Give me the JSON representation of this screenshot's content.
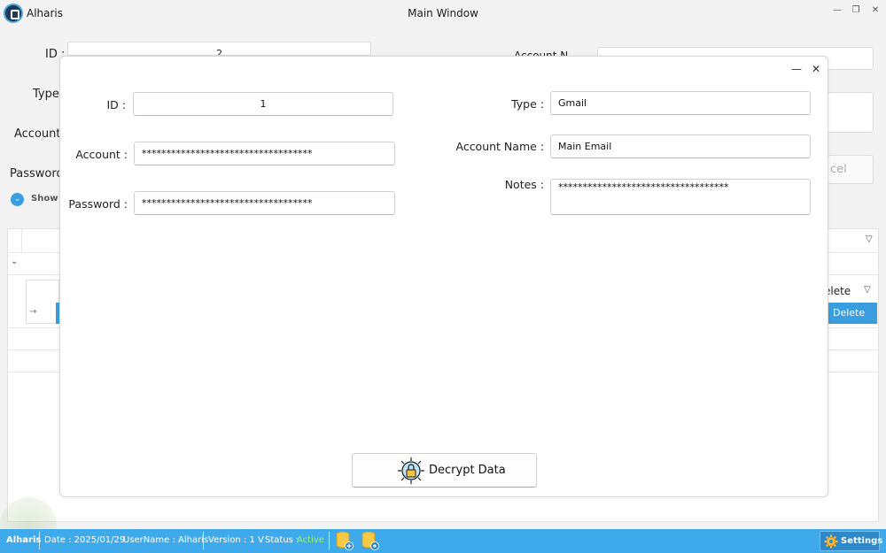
{
  "window": {
    "app_name": "Alharis",
    "title": "Main Window",
    "min_glyph": "—",
    "max_glyph": "❐",
    "close_glyph": "✕"
  },
  "background_form": {
    "id_label": "ID :",
    "id_value": "2",
    "type_label": "Type",
    "account_label": "Account",
    "password_label": "Password",
    "show_label": "Show r",
    "account_name_label": "Account N",
    "cancel_label": "cel",
    "grid": {
      "delete_header": "elete",
      "delete_button": "Delete",
      "expand_glyph": "⌄",
      "row_arrow": "→"
    }
  },
  "dialog": {
    "minimize_glyph": "—",
    "close_glyph": "✕",
    "fields": {
      "id": {
        "label": "ID :",
        "value": "1"
      },
      "account": {
        "label": "Account :",
        "value": "***********************************"
      },
      "password": {
        "label": "Password :",
        "value": "***********************************"
      },
      "type": {
        "label": "Type :",
        "value": "Gmail"
      },
      "account_name": {
        "label": "Account Name :",
        "value": "Main Email"
      },
      "notes": {
        "label": "Notes :",
        "value": "***********************************"
      }
    },
    "decrypt_button": "Decrypt Data"
  },
  "statusbar": {
    "app": "Alharis",
    "date": "Date : 2025/01/29",
    "username": "UserName : Alharis",
    "version": "Version : 1 V",
    "status_label": "Status :",
    "status_value": "Active",
    "settings": "Settings"
  },
  "colors": {
    "accent": "#3eaaec",
    "active": "#9cf07a",
    "delete_button": "#3a9de0"
  },
  "icons": [
    "app-logo-icon",
    "chevron-icon",
    "filter-icon",
    "arrow-right-icon",
    "padlock-icon",
    "database-add-icon",
    "database-settings-icon",
    "gear-icon"
  ]
}
